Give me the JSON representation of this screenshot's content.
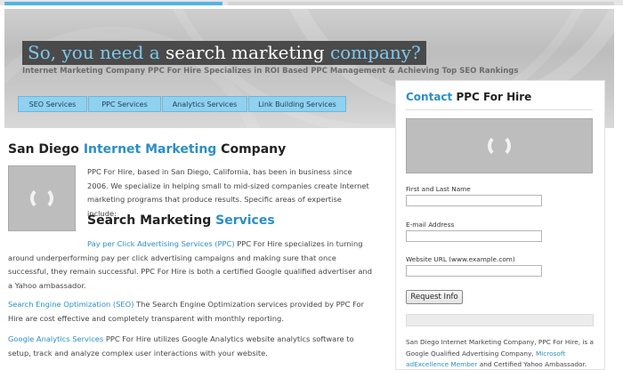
{
  "header": {
    "title_part1": "So, you need a ",
    "title_part2": "search marketing ",
    "title_part3": "company?",
    "tagline": "Internet Marketing Company PPC For Hire Specializes in ROI Based PPC Management & Achieving Top SEO Rankings"
  },
  "nav": [
    {
      "label": "SEO Services"
    },
    {
      "label": "PPC Services"
    },
    {
      "label": "Analytics Services"
    },
    {
      "label": "Link Building Services"
    }
  ],
  "main": {
    "heading_part1": "San Diego ",
    "heading_part2": "Internet Marketing",
    "heading_part3": " Company",
    "intro": "PPC For Hire, based in San Diego, California, has been in business since 2006. We specialize in helping small to mid-sized companies create Internet marketing programs that produce results. Specific areas of expertise include:",
    "subheading_part1": "Search Marketing ",
    "subheading_part2": "Services",
    "ppc_link": "Pay per Click Advertising Services (PPC)",
    "ppc_text": " PPC For Hire specializes in turning around underperforming pay per click advertising campaigns and making sure that once successful, they remain successful. PPC For Hire is both a certified Google qualified advertiser and a Yahoo ambassador.",
    "seo_link": "Search Engine Optimization (SEO)",
    "seo_text": " The Search Engine Optimization services provided by PPC For Hire are cost effective and completely transparent with monthly reporting.",
    "ga_link": "Google Analytics Services",
    "ga_text": " PPC For Hire utilizes Google Analytics website analytics software to setup, track and analyze complex user interactions with your website."
  },
  "sidebar": {
    "title_part1": "Contact",
    "title_part2": " PPC For Hire",
    "name_label": "First and Last Name",
    "email_label": "E-mail Address",
    "url_label": "Website URL (www.example.com)",
    "submit": "Request Info",
    "footer_text1": "San Diego Internet Marketing Company, PPC For Hire, is a Google Qualified Advertising Company, ",
    "footer_link": "Microsoft adExcellence Member",
    "footer_text2": " and Certified Yahoo Ambassador."
  }
}
